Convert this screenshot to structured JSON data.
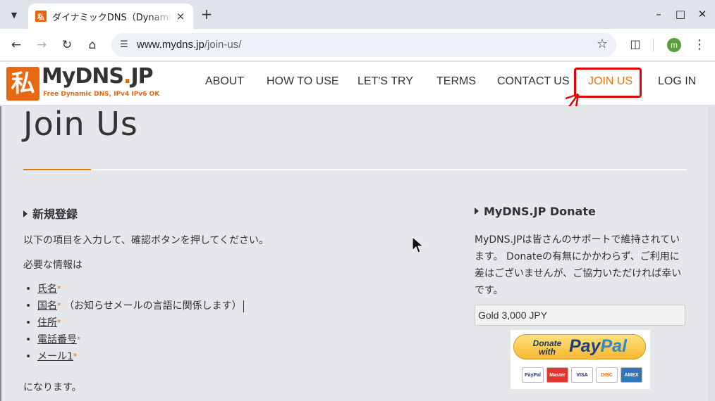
{
  "browser": {
    "tab_title": "ダイナミックDNS（Dynamic DNS）",
    "url_host": "www.mydns.jp",
    "url_path": "/join-us/",
    "profile_initial": "m"
  },
  "site": {
    "logo_text_a": "MyDNS",
    "logo_text_dot": ".",
    "logo_text_b": "JP",
    "logo_mark": "私",
    "logo_tagline": "Free Dynamic DNS, IPv4 IPv6 OK",
    "nav": [
      "ABOUT",
      "HOW TO USE",
      "LET'S TRY",
      "TERMS",
      "CONTACT US",
      "JOIN US",
      "LOG IN"
    ],
    "accent_color": "#e8760f",
    "highlight_color": "#e30000"
  },
  "page": {
    "title": "Join Us",
    "signup": {
      "heading": "新規登録",
      "intro": "以下の項目を入力して、確認ボタンを押してください。",
      "required_label": "必要な情報は",
      "fields": [
        {
          "label": "氏名",
          "note": ""
        },
        {
          "label": "国名",
          "note": "（お知らせメールの言語に関係します）"
        },
        {
          "label": "住所",
          "note": ""
        },
        {
          "label": "電話番号",
          "note": ""
        },
        {
          "label": "メール1",
          "note": ""
        }
      ],
      "required_mark": "*",
      "outro": "になります。"
    },
    "donate": {
      "heading": "MyDNS.JP Donate",
      "text": "MyDNS.JPは皆さんのサポートで維持されています。 Donateの有無にかかわらず、ご利用に差はございませんが、ご協力いただければ幸いです。",
      "selected_option": "Gold 3,000 JPY",
      "paypal_donate": "Donate with",
      "paypal_pay": "Pay",
      "paypal_pal": "Pal",
      "cards": [
        "PayPal",
        "Master",
        "VISA",
        "DISC",
        "AMEX"
      ]
    }
  }
}
